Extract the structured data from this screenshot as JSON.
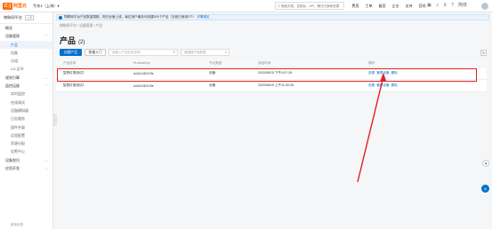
{
  "topbar": {
    "logo_mark": "C-]",
    "logo_text": "阿里云",
    "region": "华东1（上海）▾",
    "search_placeholder": "搜索文档、控制台、API、解决方案和资源",
    "nav": [
      "费用",
      "工单",
      "备案",
      "企业",
      "支持",
      "官网"
    ],
    "icons": [
      "terminal-icon",
      "bell-icon",
      "cart-icon",
      "help-icon",
      "language-icon"
    ],
    "lang": "简体"
  },
  "sidebar": {
    "title": "物联网平台",
    "title_tag": "公测",
    "items": [
      {
        "label": "概览",
        "type": "group"
      },
      {
        "label": "设备管理",
        "type": "group",
        "chev": "^"
      },
      {
        "label": "产品",
        "type": "sub",
        "active": true
      },
      {
        "label": "设备",
        "type": "sub"
      },
      {
        "label": "分组",
        "type": "sub"
      },
      {
        "label": "CA 证书",
        "type": "sub"
      },
      {
        "label": "规则引擎",
        "type": "group",
        "chev": "v"
      },
      {
        "label": "监控运维",
        "type": "group",
        "chev": "^"
      },
      {
        "label": "实时监控",
        "type": "sub"
      },
      {
        "label": "在线调试",
        "type": "sub"
      },
      {
        "label": "设备模拟器",
        "type": "sub"
      },
      {
        "label": "日志服务",
        "type": "sub"
      },
      {
        "label": "固件升级",
        "type": "sub"
      },
      {
        "label": "远程配置",
        "type": "sub"
      },
      {
        "label": "资源分配",
        "type": "sub"
      },
      {
        "label": "告警中心",
        "type": "sub"
      },
      {
        "label": "设备划归",
        "type": "group",
        "chev": "v"
      },
      {
        "label": "应用开发",
        "type": "group",
        "chev": "v"
      }
    ],
    "footer": "新版反馈"
  },
  "notice": {
    "text": "物联网平台产品数量限制，现已全面上线，每位用户最多可创建500个产品（当前已使用2个）",
    "link": "详情请见"
  },
  "main": {
    "breadcrumb": "物联网平台 / 设备管理 / 产品",
    "title": "产品",
    "count": "(2)",
    "create_button": "创建产品",
    "import_button": "快速入门",
    "search_placeholder": "请输入产品名称查询",
    "filter_placeholder": "请选择产品标签",
    "refresh_icon": "refresh-icon"
  },
  "table": {
    "headers": [
      "产品名称",
      "ProductKey",
      "节点类型",
      "添加时间",
      "操作"
    ],
    "rows": [
      {
        "name": "智慧灯具测试2",
        "key": "a1b2c3D4Y5e",
        "node": "设备",
        "time": "2020/08/15 下午4:07:28",
        "actions": [
          "查看",
          "管理设备",
          "删除"
        ]
      },
      {
        "name": "智慧灯具测试1",
        "key": "a1b2c3D4Y6e",
        "node": "设备",
        "time": "2020/08/15 上午11:30:26",
        "actions": [
          "查看",
          "管理设备",
          "删除"
        ]
      }
    ]
  },
  "colors": {
    "brand": "#ff6a00",
    "primary": "#0070cc",
    "annotation": "#e02020"
  }
}
